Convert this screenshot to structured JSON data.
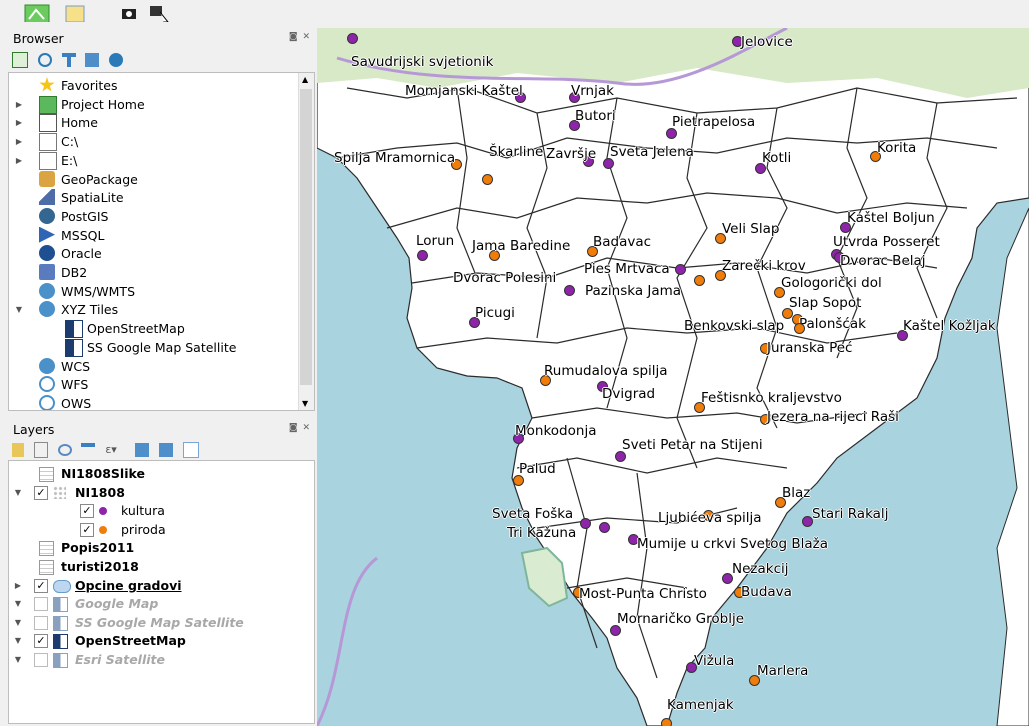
{
  "colors": {
    "kultura": "#8e24aa",
    "priroda": "#f07d0a",
    "sea": "#a9d3df",
    "land": "#ffffff",
    "border": "#2b2b2b"
  },
  "toolbar": {
    "icons": [
      "zoom-full-icon",
      "select-icon",
      "camera-icon",
      "identify-icon"
    ]
  },
  "browser": {
    "title": "Browser",
    "controls": "◙ ✕",
    "toolbar_icons": [
      "add-layer-icon",
      "refresh-icon",
      "filter-icon",
      "collapse-icon",
      "info-icon"
    ],
    "items": [
      {
        "label": "Favorites",
        "icon": "star-icon",
        "expand": ""
      },
      {
        "label": "Project Home",
        "icon": "project-home-icon",
        "expand": "▶"
      },
      {
        "label": "Home",
        "icon": "home-icon",
        "expand": "▶"
      },
      {
        "label": "C:\\",
        "icon": "drive-icon",
        "expand": "▶"
      },
      {
        "label": "E:\\",
        "icon": "drive-icon",
        "expand": "▶"
      },
      {
        "label": "GeoPackage",
        "icon": "geopackage-icon",
        "expand": ""
      },
      {
        "label": "SpatiaLite",
        "icon": "spatialite-icon",
        "expand": ""
      },
      {
        "label": "PostGIS",
        "icon": "postgis-icon",
        "expand": ""
      },
      {
        "label": "MSSQL",
        "icon": "mssql-icon",
        "expand": ""
      },
      {
        "label": "Oracle",
        "icon": "oracle-icon",
        "expand": ""
      },
      {
        "label": "DB2",
        "icon": "db2-icon",
        "expand": ""
      },
      {
        "label": "WMS/WMTS",
        "icon": "wms-icon",
        "expand": ""
      },
      {
        "label": "XYZ Tiles",
        "icon": "xyz-icon",
        "expand": "▼"
      },
      {
        "label": "OpenStreetMap",
        "icon": "tile-icon",
        "expand": "",
        "child": true
      },
      {
        "label": "SS Google Map Satellite",
        "icon": "tile-icon",
        "expand": "",
        "child": true
      },
      {
        "label": "WCS",
        "icon": "wcs-icon",
        "expand": ""
      },
      {
        "label": "WFS",
        "icon": "wfs-icon",
        "expand": ""
      },
      {
        "label": "OWS",
        "icon": "ows-icon",
        "expand": ""
      }
    ]
  },
  "layers": {
    "title": "Layers",
    "controls": "◙ ✕",
    "toolbar_icons": [
      "style-icon",
      "add-group-icon",
      "visibility-icon",
      "filter-icon",
      "expression-icon",
      "expand-all-icon",
      "collapse-all-icon",
      "remove-layer-icon"
    ],
    "items": [
      {
        "label": "NI1808Slike",
        "style": "bold",
        "checkbox": "",
        "expand": "",
        "icon": "table-icon",
        "indent": 0
      },
      {
        "label": "NI1808",
        "style": "bold",
        "checkbox": "✓",
        "expand": "▼",
        "icon": "points-icon",
        "indent": 0
      },
      {
        "label": "kultura",
        "style": "normal",
        "checkbox": "✓",
        "expand": "",
        "icon": "kultura-dot",
        "indent": 1
      },
      {
        "label": "priroda",
        "style": "normal",
        "checkbox": "✓",
        "expand": "",
        "icon": "priroda-dot",
        "indent": 1
      },
      {
        "label": "Popis2011",
        "style": "bold",
        "checkbox": "",
        "expand": "",
        "icon": "table-icon",
        "indent": 0
      },
      {
        "label": "turisti2018",
        "style": "bold",
        "checkbox": "",
        "expand": "",
        "icon": "table-icon",
        "indent": 0
      },
      {
        "label": "Opcine gradovi",
        "style": "bold-underline",
        "checkbox": "✓",
        "expand": "▶",
        "icon": "polygon-icon",
        "indent": 0
      },
      {
        "label": "Google Map",
        "style": "grey",
        "checkbox": " ",
        "expand": "▼",
        "icon": "tile-icon",
        "indent": 0
      },
      {
        "label": "SS Google Map Satellite",
        "style": "grey",
        "checkbox": " ",
        "expand": "▼",
        "icon": "tile-icon",
        "indent": 0
      },
      {
        "label": "OpenStreetMap",
        "style": "bold",
        "checkbox": "✓",
        "expand": "▼",
        "icon": "tile-icon",
        "indent": 0
      },
      {
        "label": "Esri Satellite",
        "style": "grey",
        "checkbox": " ",
        "expand": "▼",
        "icon": "tile-icon",
        "indent": 0
      }
    ]
  },
  "map": {
    "places": [
      {
        "name": "Savudrijski svjetionik",
        "type": "kultura"
      },
      {
        "name": "Jelovice",
        "type": "kultura"
      },
      {
        "name": "Momjanski Kaštel",
        "type": "kultura"
      },
      {
        "name": "Vrnjak",
        "type": "kultura"
      },
      {
        "name": "Butori",
        "type": "kultura"
      },
      {
        "name": "Pietrapelosa",
        "type": "kultura"
      },
      {
        "name": "Spilja Mramornica",
        "type": "priroda"
      },
      {
        "name": "Škarline",
        "type": "priroda"
      },
      {
        "name": "Završje",
        "type": "kultura"
      },
      {
        "name": "Sveta Jelena",
        "type": "kultura"
      },
      {
        "name": "Kotli",
        "type": "kultura"
      },
      {
        "name": "Korita",
        "type": "priroda"
      },
      {
        "name": "Kaštel Boljun",
        "type": "kultura"
      },
      {
        "name": "Veli Slap",
        "type": "priroda"
      },
      {
        "name": "Lorun",
        "type": "kultura"
      },
      {
        "name": "Jama Baredine",
        "type": "priroda"
      },
      {
        "name": "Badavac",
        "type": "priroda"
      },
      {
        "name": "Utvrda Posseret",
        "type": "kultura"
      },
      {
        "name": "Dvorac Belaj",
        "type": "kultura"
      },
      {
        "name": "Pies Mrtvaca",
        "type": "kultura"
      },
      {
        "name": "Zarečki krov",
        "type": "priroda"
      },
      {
        "name": "Dvorac Polesini",
        "type": "kultura"
      },
      {
        "name": "Pazinska Jama",
        "type": "priroda"
      },
      {
        "name": "Gologorički dol",
        "type": "priroda"
      },
      {
        "name": "Slap Sopot",
        "type": "priroda"
      },
      {
        "name": "Picugi",
        "type": "kultura"
      },
      {
        "name": "Palonšćak",
        "type": "priroda"
      },
      {
        "name": "Benkovski slap",
        "type": "priroda"
      },
      {
        "name": "Kaštel Kožljak",
        "type": "kultura"
      },
      {
        "name": "Juranska Peć",
        "type": "priroda"
      },
      {
        "name": "Rumudalova spilja",
        "type": "priroda"
      },
      {
        "name": "Dvigrad",
        "type": "kultura"
      },
      {
        "name": "Feštisnko kraljevstvo",
        "type": "priroda"
      },
      {
        "name": "Jezera na rijeci Raši",
        "type": "priroda"
      },
      {
        "name": "Monkodonja",
        "type": "kultura"
      },
      {
        "name": "Sveti Petar na Stijeni",
        "type": "kultura"
      },
      {
        "name": "Palud",
        "type": "priroda"
      },
      {
        "name": "Blaz",
        "type": "priroda"
      },
      {
        "name": "Sveta Foška",
        "type": "kultura"
      },
      {
        "name": "Tri Kažuna",
        "type": "kultura"
      },
      {
        "name": "Ljubićeva spilja",
        "type": "priroda"
      },
      {
        "name": "Stari Rakalj",
        "type": "kultura"
      },
      {
        "name": "Mumije u crkvi Svetog Blaža",
        "type": "kultura"
      },
      {
        "name": "Nezakcij",
        "type": "kultura"
      },
      {
        "name": "Most-Punta Christo",
        "type": "priroda"
      },
      {
        "name": "Budava",
        "type": "priroda"
      },
      {
        "name": "Mornaričko Groblje",
        "type": "kultura"
      },
      {
        "name": "Vižula",
        "type": "kultura"
      },
      {
        "name": "Marlera",
        "type": "priroda"
      },
      {
        "name": "Kamenjak",
        "type": "priroda"
      }
    ]
  }
}
